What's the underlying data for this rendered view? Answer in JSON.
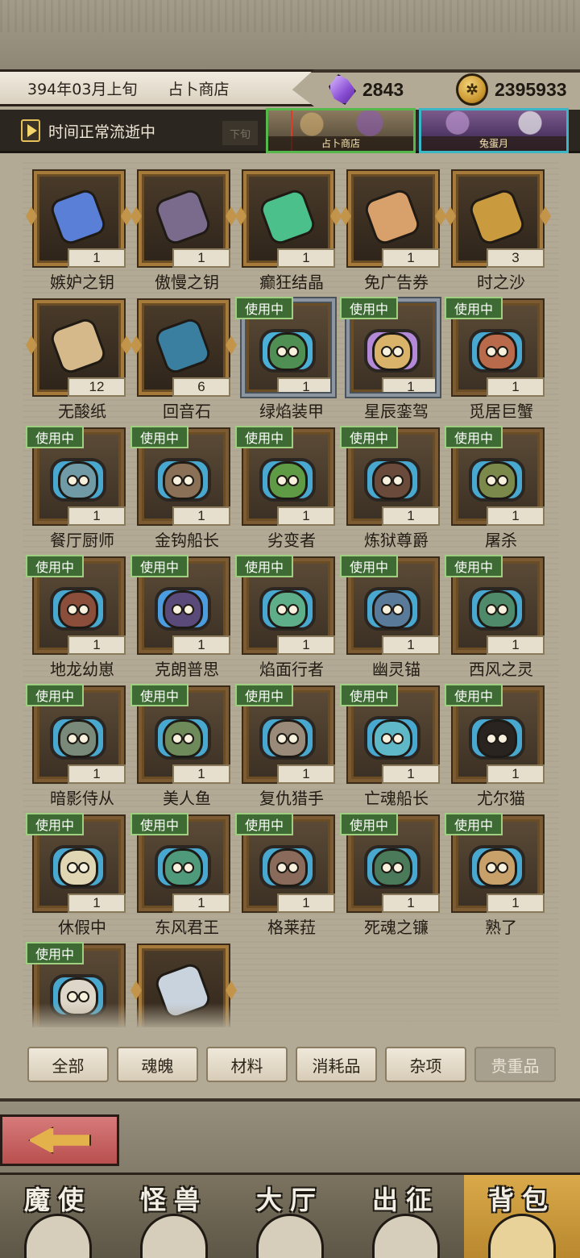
{
  "header": {
    "date": "394年03月上旬",
    "location": "占卜商店",
    "crystals": "2843",
    "coins": "2395933",
    "crystal_icon": "purple-crystal-icon",
    "coin_icon": "gold-coin-icon"
  },
  "status": {
    "text": "时间正常流逝中",
    "ghost": "下旬"
  },
  "events": [
    {
      "label": "占卜商店"
    },
    {
      "label": "兔蛋月"
    }
  ],
  "items": [
    {
      "name": "嫉妒之钥",
      "count": "1",
      "equipped": false,
      "icon": "blue-key-icon",
      "color": "#5a7fd6"
    },
    {
      "name": "傲慢之钥",
      "count": "1",
      "equipped": false,
      "icon": "axe-key-icon",
      "color": "#7a6b8c"
    },
    {
      "name": "癫狂结晶",
      "count": "1",
      "equipped": false,
      "icon": "green-crystal-icon",
      "color": "#4cc08a"
    },
    {
      "name": "免广告券",
      "count": "1",
      "equipped": false,
      "icon": "ticket-icon",
      "color": "#d8a06a"
    },
    {
      "name": "时之沙",
      "count": "3",
      "equipped": false,
      "icon": "sand-icon",
      "color": "#c99a3e"
    },
    {
      "name": "无酸纸",
      "count": "12",
      "equipped": false,
      "icon": "paper-scroll-icon",
      "color": "#d6b98a"
    },
    {
      "name": "回音石",
      "count": "6",
      "equipped": false,
      "icon": "echo-stone-icon",
      "color": "#3a7fa0"
    },
    {
      "name": "绿焰装甲",
      "count": "1",
      "equipped": true,
      "chained": true,
      "icon": "green-armor-icon",
      "color": "#4f8f54",
      "ring": "#4bb0d8"
    },
    {
      "name": "星辰銮驾",
      "count": "1",
      "equipped": true,
      "chained": true,
      "icon": "star-carriage-icon",
      "color": "#d9b36a",
      "ring": "#b48ad8"
    },
    {
      "name": "觅居巨蟹",
      "count": "1",
      "equipped": true,
      "icon": "crab-icon",
      "color": "#b86a4a",
      "ring": "#49a8cf"
    },
    {
      "name": "餐厅厨师",
      "count": "1",
      "equipped": true,
      "icon": "chef-icon",
      "color": "#6f9aa6",
      "ring": "#49a8cf"
    },
    {
      "name": "金钩船长",
      "count": "1",
      "equipped": true,
      "icon": "captain-icon",
      "color": "#8a7056",
      "ring": "#49a8cf"
    },
    {
      "name": "劣变者",
      "count": "1",
      "equipped": true,
      "icon": "mutant-icon",
      "color": "#5f9a44",
      "ring": "#49a8cf"
    },
    {
      "name": "炼狱尊爵",
      "count": "1",
      "equipped": true,
      "icon": "inferno-lord-icon",
      "color": "#6a4a3a",
      "ring": "#49a8cf"
    },
    {
      "name": "屠杀",
      "count": "1",
      "equipped": true,
      "icon": "slaughter-icon",
      "color": "#7b8a4a",
      "ring": "#49a8cf"
    },
    {
      "name": "地龙幼崽",
      "count": "1",
      "equipped": true,
      "icon": "earth-dragon-icon",
      "color": "#8a4e3a",
      "ring": "#49a8cf"
    },
    {
      "name": "克朗普思",
      "count": "1",
      "equipped": true,
      "icon": "krampus-icon",
      "color": "#5a4a7a",
      "ring": "#4b9de0"
    },
    {
      "name": "焰面行者",
      "count": "1",
      "equipped": true,
      "icon": "flame-walker-icon",
      "color": "#5fae8a",
      "ring": "#49a8cf"
    },
    {
      "name": "幽灵锚",
      "count": "1",
      "equipped": true,
      "icon": "ghost-anchor-icon",
      "color": "#5a7a9a",
      "ring": "#49a8cf"
    },
    {
      "name": "西风之灵",
      "count": "1",
      "equipped": true,
      "icon": "west-wind-icon",
      "color": "#4f8a6a",
      "ring": "#49a8cf"
    },
    {
      "name": "暗影侍从",
      "count": "1",
      "equipped": true,
      "icon": "shadow-servant-icon",
      "color": "#7a8a7a",
      "ring": "#49a8cf"
    },
    {
      "name": "美人鱼",
      "count": "1",
      "equipped": true,
      "icon": "mermaid-icon",
      "color": "#6f8a5a",
      "ring": "#49a8cf"
    },
    {
      "name": "复仇猎手",
      "count": "1",
      "equipped": true,
      "icon": "avenger-icon",
      "color": "#9a8a7a",
      "ring": "#49a8cf"
    },
    {
      "name": "亡魂船长",
      "count": "1",
      "equipped": true,
      "icon": "ghost-captain-icon",
      "color": "#5fb8c8",
      "ring": "#49a8cf"
    },
    {
      "name": "尤尔猫",
      "count": "1",
      "equipped": true,
      "icon": "yule-cat-icon",
      "color": "#2a2420",
      "ring": "#49a8cf"
    },
    {
      "name": "休假中",
      "count": "1",
      "equipped": true,
      "icon": "vacation-icon",
      "color": "#e0d6b4",
      "ring": "#49a8cf"
    },
    {
      "name": "东风君王",
      "count": "1",
      "equipped": true,
      "icon": "east-wind-king-icon",
      "color": "#4f9a7a",
      "ring": "#49a8cf"
    },
    {
      "name": "格莱菈",
      "count": "1",
      "equipped": true,
      "icon": "grila-icon",
      "color": "#8a6a5a",
      "ring": "#49a8cf"
    },
    {
      "name": "死魂之镰",
      "count": "1",
      "equipped": true,
      "icon": "death-scythe-icon",
      "color": "#4a7a5a",
      "ring": "#49a8cf"
    },
    {
      "name": "熟了",
      "count": "1",
      "equipped": true,
      "icon": "cooked-icon",
      "color": "#c8a06a",
      "ring": "#49a8cf"
    },
    {
      "name": "",
      "count": "",
      "equipped": true,
      "icon": "cauliflower-icon",
      "color": "#ded6c8",
      "ring": "#49a8cf"
    },
    {
      "name": "",
      "count": "",
      "equipped": false,
      "icon": "orb-icon",
      "color": "#c9d3de"
    }
  ],
  "labels": {
    "equipped": "使用中"
  },
  "filters": [
    {
      "label": "全部",
      "active": false
    },
    {
      "label": "魂魄",
      "active": false
    },
    {
      "label": "材料",
      "active": false
    },
    {
      "label": "消耗品",
      "active": false
    },
    {
      "label": "杂项",
      "active": false
    },
    {
      "label": "贵重品",
      "active": true
    }
  ],
  "back_icon": "back-arrow-icon",
  "nav": [
    {
      "label": "魔使",
      "icon": "skull-emblem-icon",
      "active": false
    },
    {
      "label": "怪兽",
      "icon": "monster-emblem-icon",
      "active": false
    },
    {
      "label": "大厅",
      "icon": "hall-emblem-icon",
      "active": false
    },
    {
      "label": "出征",
      "icon": "expedition-emblem-icon",
      "active": false
    },
    {
      "label": "背包",
      "icon": "backpack-icon",
      "active": true
    }
  ]
}
